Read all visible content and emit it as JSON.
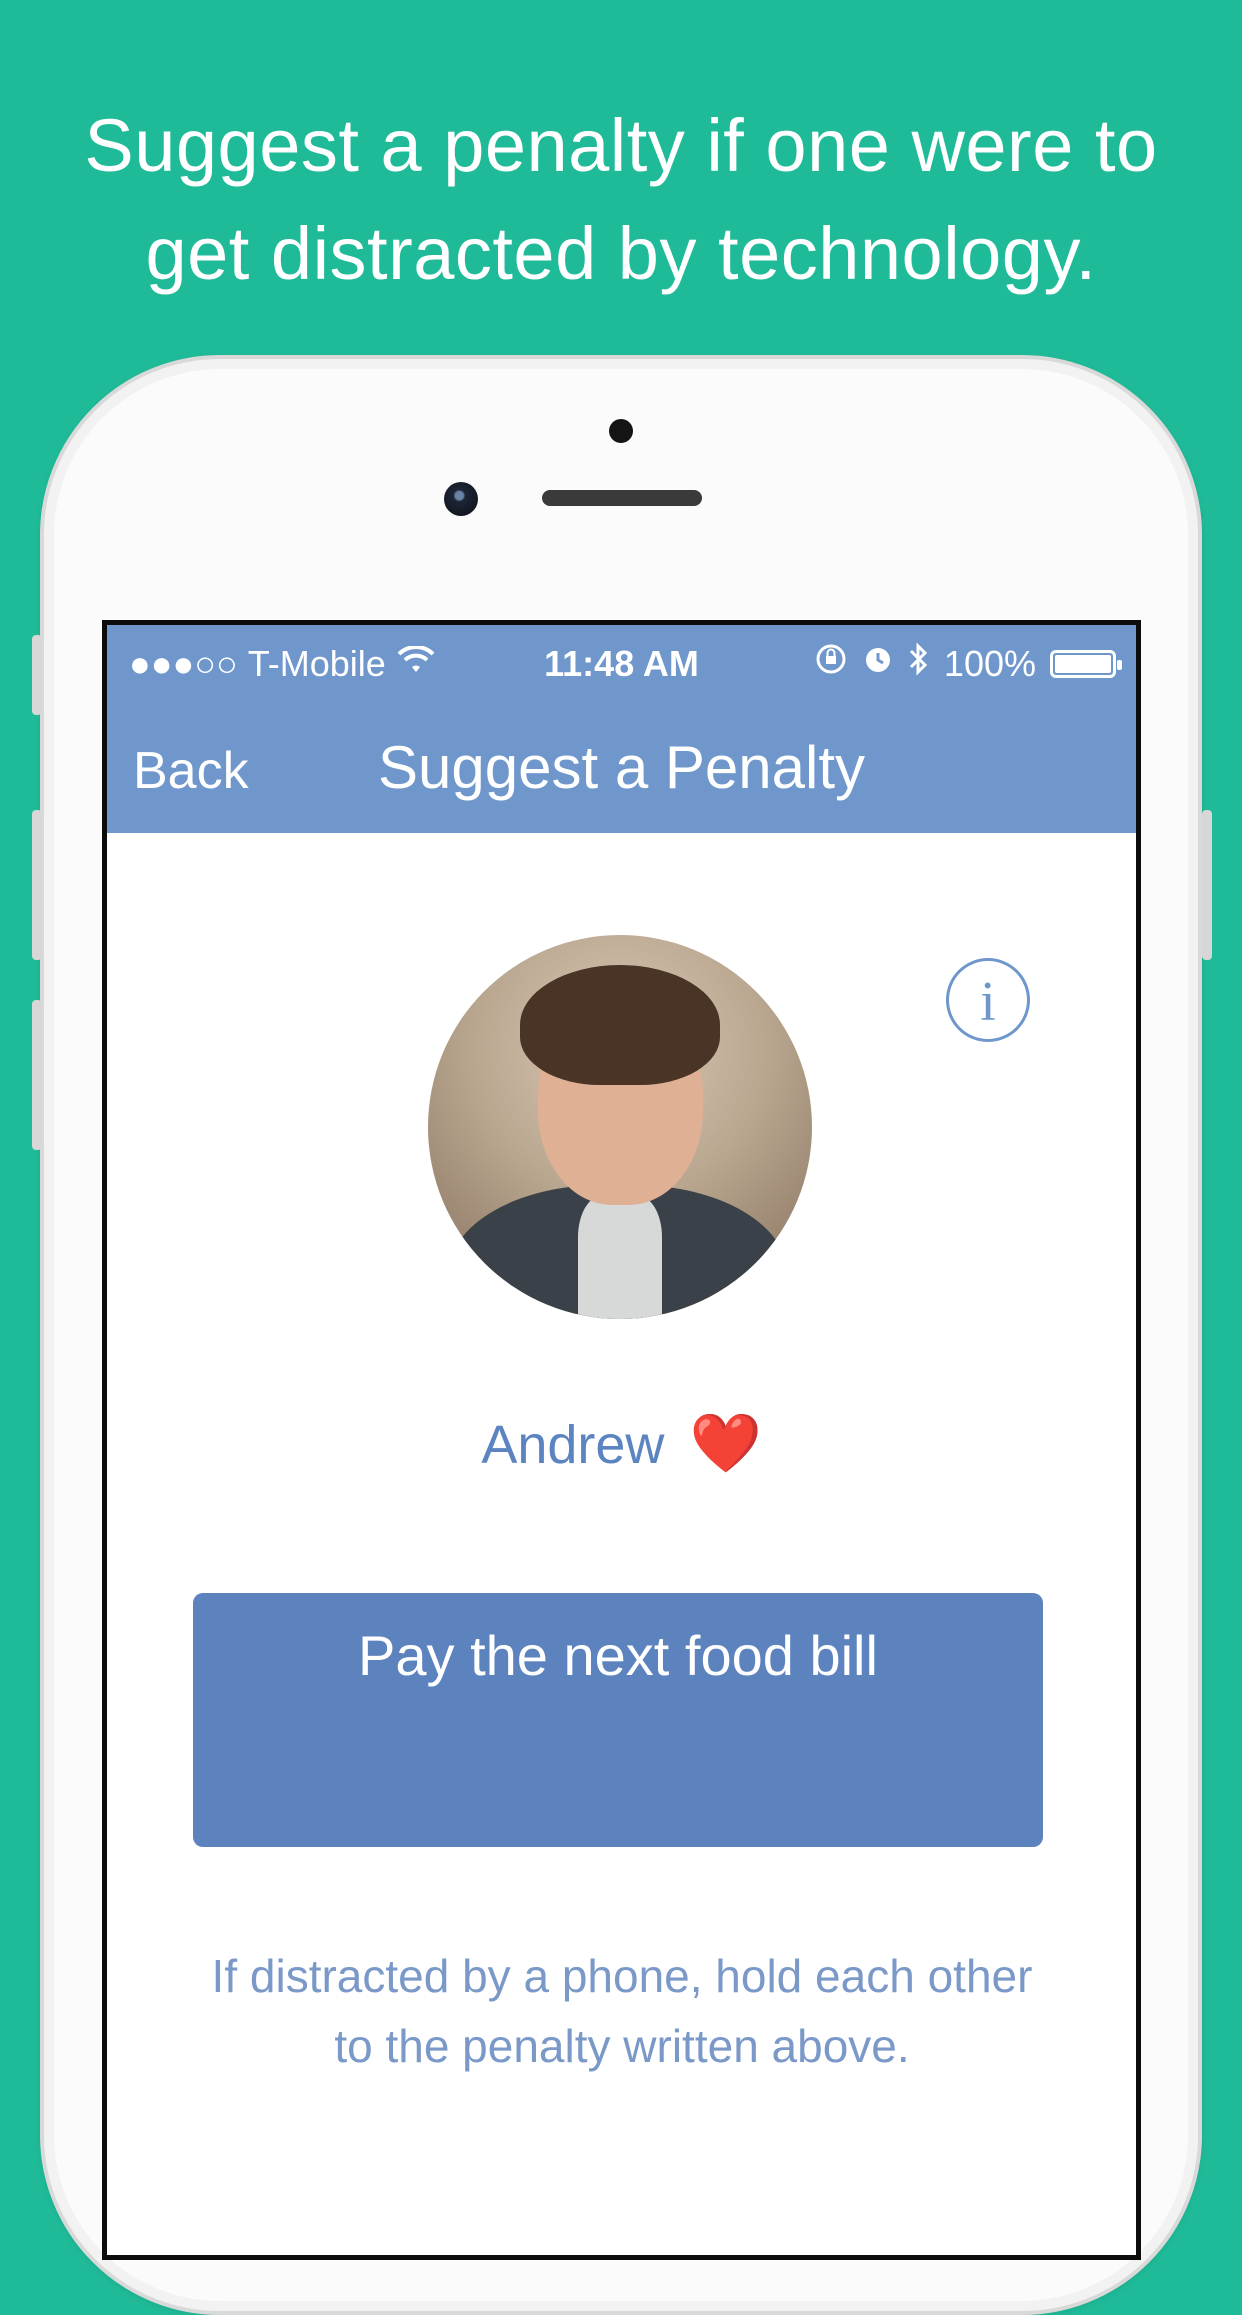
{
  "headline": {
    "line1": "Suggest a penalty if one were to",
    "line2": "get distracted by technology."
  },
  "status_bar": {
    "signal": "●●●○○",
    "carrier": "T-Mobile",
    "wifi_icon": "wifi-icon",
    "time": "11:48 AM",
    "icons": [
      "orientation-lock-icon",
      "alarm-icon",
      "bluetooth-icon"
    ],
    "battery_text": "100%",
    "battery_level": 1.0
  },
  "nav": {
    "back_label": "Back",
    "title": "Suggest a Penalty"
  },
  "profile": {
    "name": "Andrew",
    "emoji": "❤️",
    "info_icon": "info-icon"
  },
  "penalty": {
    "text": "Pay the next food bill"
  },
  "hint": {
    "line1": "If distracted by a phone, hold each other",
    "line2": "to the penalty written above."
  },
  "colors": {
    "background": "#1fbb98",
    "nav_blue": "#6f97cc",
    "penalty_blue": "#5d83bf",
    "text_blue": "#5b84c0",
    "heart": "#e02020"
  }
}
